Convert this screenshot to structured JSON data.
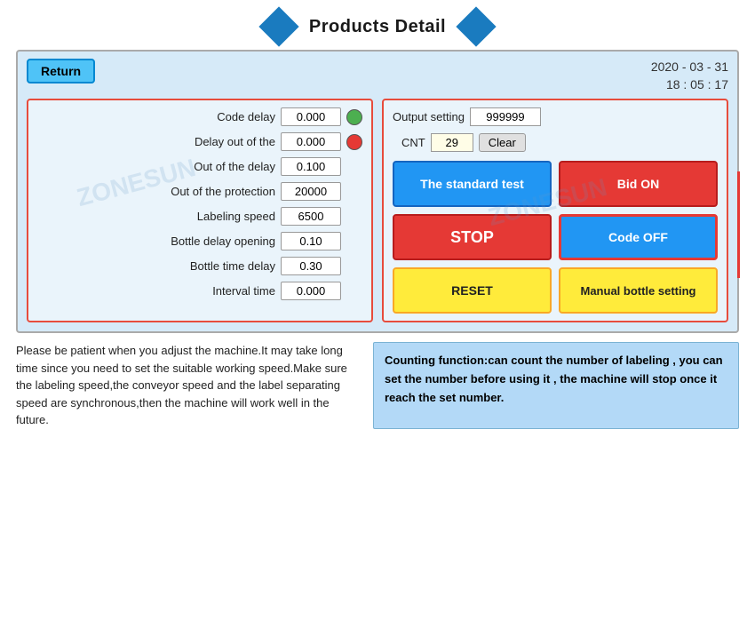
{
  "header": {
    "title": "Products Detail"
  },
  "datetime": {
    "date": "2020 - 03 - 31",
    "time": "18 : 05 : 17"
  },
  "buttons": {
    "return": "Return",
    "clear": "Clear",
    "standard_test": "The standard test",
    "bid_on": "Bid ON",
    "stop": "STOP",
    "code_off": "Code OFF",
    "reset": "RESET",
    "manual_bottle": "Manual bottle setting"
  },
  "left_fields": [
    {
      "label": "Code delay",
      "value": "0.000",
      "indicator": "green"
    },
    {
      "label": "Delay out of the",
      "value": "0.000",
      "indicator": "red"
    },
    {
      "label": "Out of the delay",
      "value": "0.100",
      "indicator": "none"
    },
    {
      "label": "Out of the protection",
      "value": "20000",
      "indicator": "none"
    },
    {
      "label": "Labeling speed",
      "value": "6500",
      "indicator": "none"
    },
    {
      "label": "Bottle delay opening",
      "value": "0.10",
      "indicator": "none"
    },
    {
      "label": "Bottle time delay",
      "value": "0.30",
      "indicator": "none"
    },
    {
      "label": "Interval time",
      "value": "0.000",
      "indicator": "none"
    }
  ],
  "right": {
    "output_label": "Output setting",
    "output_value": "999999",
    "cnt_label": "CNT",
    "cnt_value": "29"
  },
  "watermark": "ZONESUN",
  "bottom_left": "Please be patient when you adjust the machine.It may take long time since you need to set the suitable working speed.Make sure the labeling speed,the conveyor speed and the label separating speed are synchronous,then the machine will work well in the future.",
  "bottom_right": "Counting function:can count the number of labeling , you can set the number before using it , the machine will stop once it reach the set number."
}
